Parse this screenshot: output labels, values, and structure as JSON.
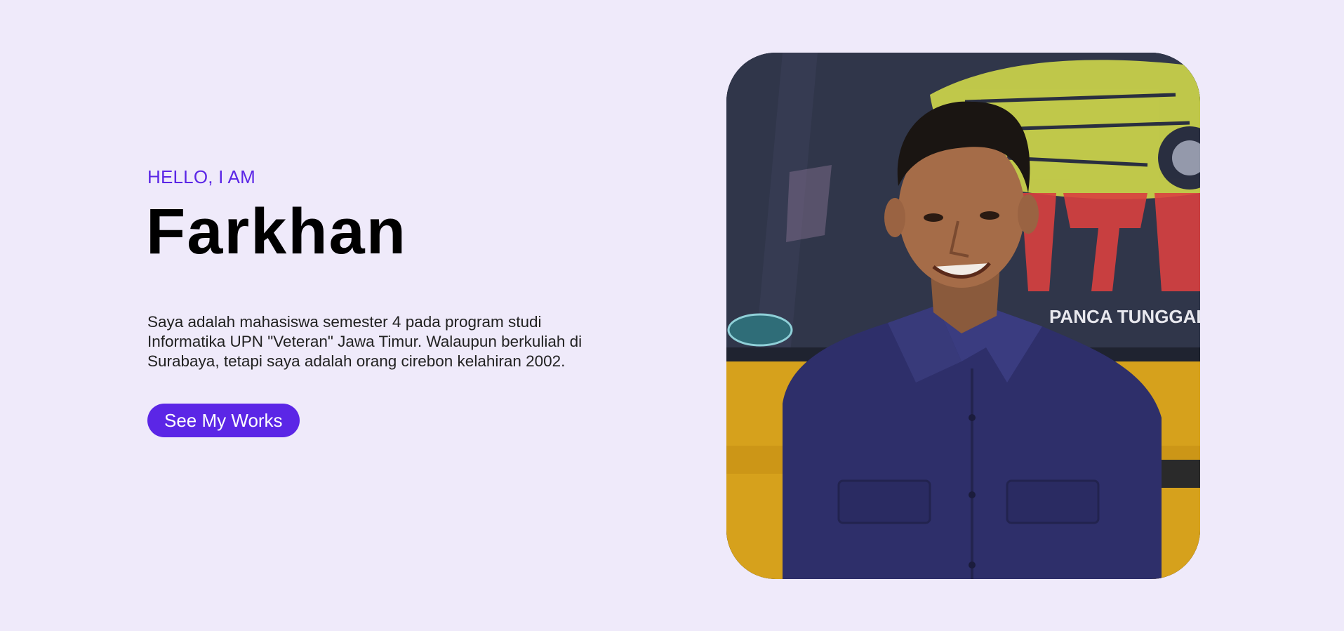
{
  "hero": {
    "greeting": "HELLO, I AM",
    "name": "Farkhan",
    "bio": "Saya adalah mahasiswa semester 4 pada program studi Informatika UPN \"Veteran\" Jawa Timur. Walaupun berkuliah di Surabaya, tetapi saya adalah orang cirebon kelahiran 2002.",
    "cta_label": "See My Works"
  },
  "photo": {
    "icon": "portrait-photo"
  },
  "colors": {
    "background": "#efeafa",
    "accent": "#5b26e6",
    "text": "#000000"
  }
}
